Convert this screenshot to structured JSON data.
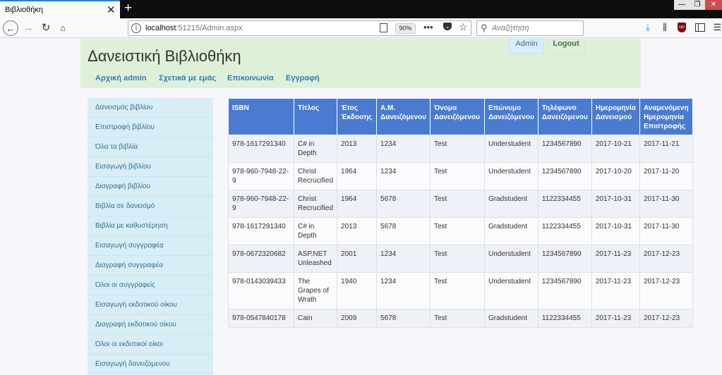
{
  "browser": {
    "tab_title": "Βιβλιοθήκη",
    "tab_close": "✕",
    "new_tab": "+",
    "url_host": "localhost",
    "url_rest": ":51215/Admin.aspx",
    "zoom": "90%",
    "search_placeholder": "Αναζήτηση",
    "win_min": "—",
    "win_max": "❐",
    "win_close": "✕"
  },
  "header": {
    "title": "Δανειστική Βιβλιοθήκη",
    "admin_label": "Admin",
    "logout_label": "Logout",
    "nav": [
      "Αρχική admin",
      "Σχετικά με εμάς",
      "Επικοινωνία",
      "Εγγραφή"
    ]
  },
  "sidebar": {
    "items": [
      "Δανεισμός βιβλίου",
      "Επιστροφή βιβλίου",
      "Όλα τα βιβλία",
      "Εισαγωγή βιβλίου",
      "Διαγραφή βιβλίου",
      "Βιβλία σε δανεισμό",
      "Βιβλία με καθυστέρηση",
      "Εισαγωγή συγγραφέα",
      "Διαγραφή συγγραφέα",
      "Όλοι οι συγγραφείς",
      "Εισαγωγή εκδοτικού οίκου",
      "Διαγραφή εκδοτικού οίκου",
      "Όλοι οι εκδοτικοί οίκοι",
      "Εισαγωγή δανειζόμενου"
    ]
  },
  "table": {
    "headers": [
      [
        "ISBN"
      ],
      [
        "Τίτλος"
      ],
      [
        "Έτος",
        "Έκδοσης"
      ],
      [
        "Α.Μ.",
        "Δανειζόμενου"
      ],
      [
        "Όνομα",
        "Δανειζόμενου"
      ],
      [
        "Επώνυμο",
        "Δανειζόμενου"
      ],
      [
        "Τηλέφωνο",
        "Δανειζόμενου"
      ],
      [
        "Ημερομηνία",
        "Δανεισμού"
      ],
      [
        "Αναμενόμενη",
        "Ημερομηνία",
        "Επιστροφής"
      ]
    ],
    "rows": [
      [
        [
          "978-1617291340"
        ],
        [
          "C# in",
          "Depth"
        ],
        [
          "2013"
        ],
        [
          "1234"
        ],
        [
          "Test"
        ],
        [
          "Understudent"
        ],
        [
          "1234567890"
        ],
        [
          "2017-10-21"
        ],
        [
          "2017-11-21"
        ]
      ],
      [
        [
          "978-960-7948-22-9"
        ],
        [
          "Christ",
          "Recrucified"
        ],
        [
          "1964"
        ],
        [
          "1234"
        ],
        [
          "Test"
        ],
        [
          "Understudent"
        ],
        [
          "1234567890"
        ],
        [
          "2017-10-20"
        ],
        [
          "2017-11-20"
        ]
      ],
      [
        [
          "978-960-7948-22-9"
        ],
        [
          "Christ",
          "Recrucified"
        ],
        [
          "1964"
        ],
        [
          "5678"
        ],
        [
          "Test"
        ],
        [
          "Gradstudent"
        ],
        [
          "1122334455"
        ],
        [
          "2017-10-31"
        ],
        [
          "2017-11-30"
        ]
      ],
      [
        [
          "978-1617291340"
        ],
        [
          "C# in",
          "Depth"
        ],
        [
          "2013"
        ],
        [
          "5678"
        ],
        [
          "Test"
        ],
        [
          "Gradstudent"
        ],
        [
          "1122334455"
        ],
        [
          "2017-10-31"
        ],
        [
          "2017-11-30"
        ]
      ],
      [
        [
          "978-0672320682"
        ],
        [
          "ASP.NET",
          "Unleashed"
        ],
        [
          "2001"
        ],
        [
          "1234"
        ],
        [
          "Test"
        ],
        [
          "Understudent"
        ],
        [
          "1234567890"
        ],
        [
          "2017-11-23"
        ],
        [
          "2017-12-23"
        ]
      ],
      [
        [
          "978-0143039433"
        ],
        [
          "The",
          "Grapes of",
          "Wrath"
        ],
        [
          "1940"
        ],
        [
          "1234"
        ],
        [
          "Test"
        ],
        [
          "Understudent"
        ],
        [
          "1234567890"
        ],
        [
          "2017-11-23"
        ],
        [
          "2017-12-23"
        ]
      ],
      [
        [
          "978-0547840178"
        ],
        [
          "Cain"
        ],
        [
          "2009"
        ],
        [
          "5678"
        ],
        [
          "Test"
        ],
        [
          "Gradstudent"
        ],
        [
          "1122334455"
        ],
        [
          "2017-11-23"
        ],
        [
          "2017-12-23"
        ]
      ]
    ]
  }
}
